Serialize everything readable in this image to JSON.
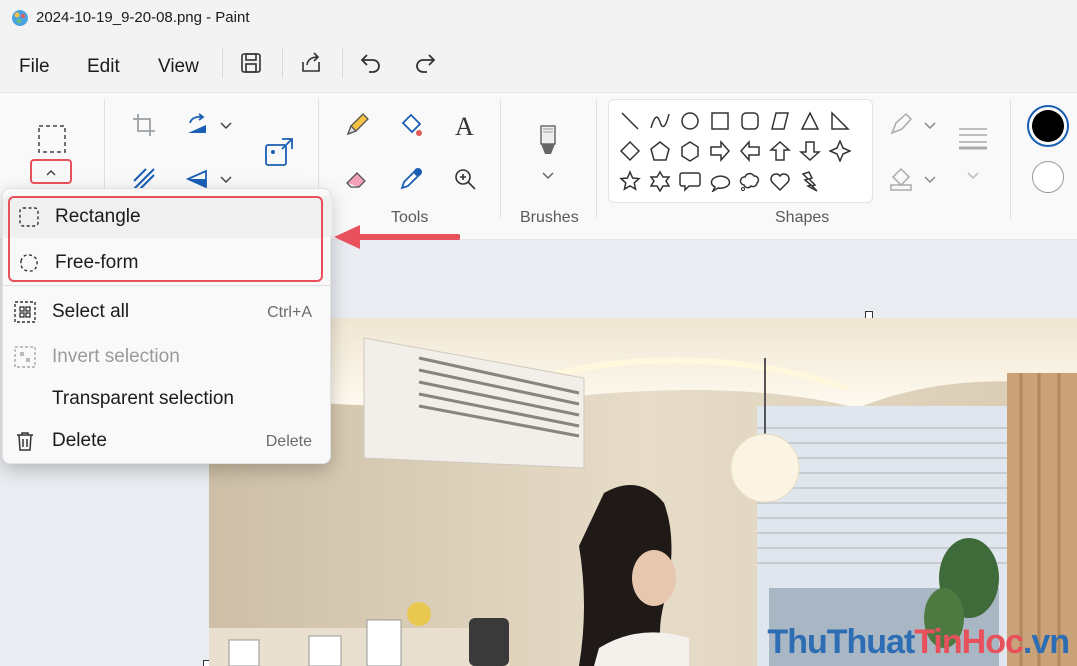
{
  "window": {
    "title": "2024-10-19_9-20-08.png - Paint"
  },
  "menubar": {
    "file": "File",
    "edit": "Edit",
    "view": "View"
  },
  "ribbon": {
    "tools_label": "Tools",
    "brushes_label": "Brushes",
    "shapes_label": "Shapes"
  },
  "colors": {
    "primary": "#000000",
    "secondary": "#ffffff",
    "accent": "#e8505b"
  },
  "selection_menu": {
    "items": [
      {
        "label": "Rectangle",
        "icon": "rectangle-select-icon",
        "shortcut": ""
      },
      {
        "label": "Free-form",
        "icon": "freeform-select-icon",
        "shortcut": ""
      },
      {
        "label": "Select all",
        "icon": "select-all-icon",
        "shortcut": "Ctrl+A"
      },
      {
        "label": "Invert selection",
        "icon": "invert-selection-icon",
        "shortcut": ""
      },
      {
        "label": "Transparent selection",
        "icon": "",
        "shortcut": ""
      },
      {
        "label": "Delete",
        "icon": "trash-icon",
        "shortcut": "Delete"
      }
    ]
  },
  "watermark": {
    "part1": "ThuThuat",
    "part2": "TinHoc",
    "part3": ".vn"
  }
}
